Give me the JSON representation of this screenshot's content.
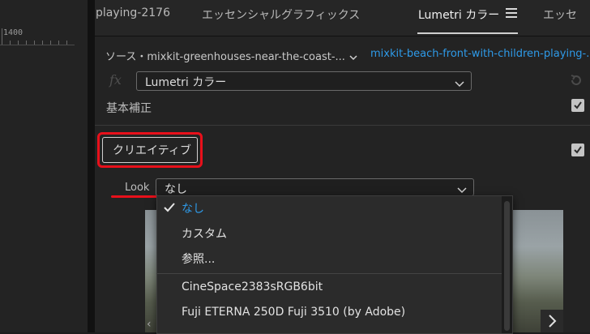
{
  "timeline": {
    "ruler_value": "1400"
  },
  "tabs": [
    {
      "label": "playing-2176"
    },
    {
      "label": "エッセンシャルグラフィックス"
    },
    {
      "label": "Lumetri カラー"
    },
    {
      "label": "エッセ"
    }
  ],
  "source": {
    "master_label": "ソース・mixkit-greenhouses-near-the-coast-...",
    "clip_label": "mixkit-beach-front-with-children-playing-..."
  },
  "effect": {
    "fx_icon": "fx",
    "selected": "Lumetri カラー"
  },
  "sections": {
    "basic": "基本補正",
    "creative": "クリエイティブ"
  },
  "look": {
    "label": "Look",
    "value": "なし"
  },
  "dropdown": {
    "items": [
      "なし",
      "カスタム",
      "参照...",
      "CineSpace2383sRGB6bit",
      "Fuji ETERNA 250D Fuji 3510 (by Adobe)"
    ],
    "selected_index": 0
  },
  "colors": {
    "accent_blue": "#2e9ae8",
    "highlight_red": "#e8101b"
  }
}
